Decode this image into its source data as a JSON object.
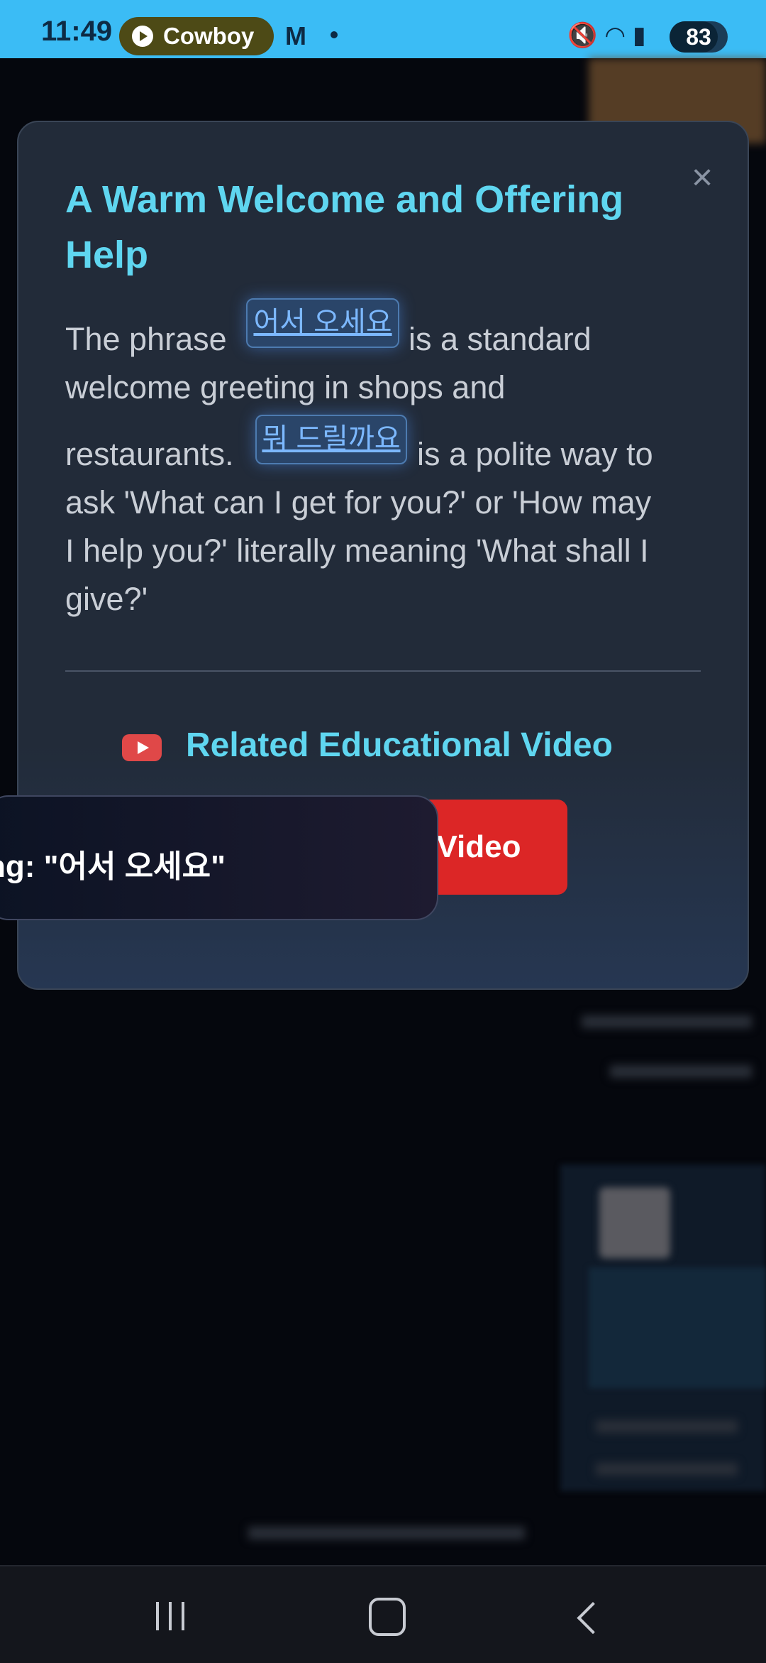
{
  "status_bar": {
    "time": "11:49",
    "media_label": "Cowboy",
    "gmail_glyph": "M",
    "battery": "83"
  },
  "modal": {
    "title": "A Warm Welcome and Offering Help",
    "close_label": "×",
    "body": {
      "intro": "The phrase",
      "term1": "어서 오세요",
      "after_term1": "is a standard",
      "line2": "welcome greeting in shops and",
      "line3_start": "restaurants.",
      "term2": "뭐 드릴까요",
      "after_term2": "is a polite way to",
      "line4": "ask 'What can I get for you?' or 'How may",
      "line5": "I help you?' literally meaning 'What shall I",
      "line6": "give?'"
    },
    "video_section_title": "Related Educational Video",
    "video_button_label": "Video"
  },
  "toast": {
    "text": "ng: \"어서 오세요\""
  },
  "nav": {
    "recent_icon": "recent-apps-icon",
    "home_icon": "home-icon",
    "back_icon": "back-icon"
  },
  "colors": {
    "status_bar": "#3bbcf5",
    "accent": "#5fd6f0",
    "video_button": "#dc2626",
    "chip_text": "#7cb8ff"
  }
}
